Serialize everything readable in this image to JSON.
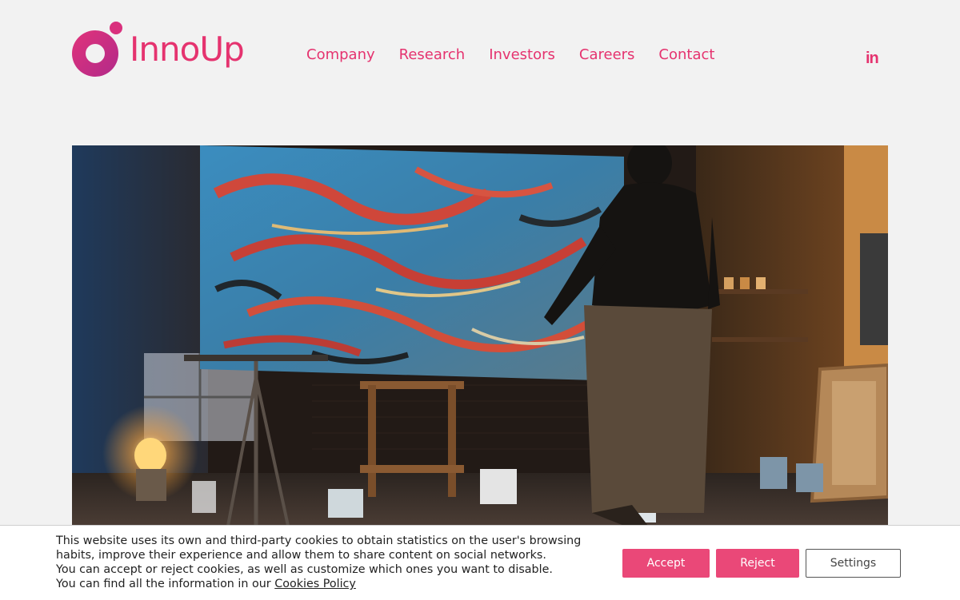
{
  "brand": {
    "name": "InnoUp",
    "accent": "#e5336f",
    "logo_gradient": [
      "#e1337a",
      "#b12a8a"
    ]
  },
  "nav": {
    "items": [
      {
        "label": "Company"
      },
      {
        "label": "Research"
      },
      {
        "label": "Investors"
      },
      {
        "label": "Careers"
      },
      {
        "label": "Contact"
      }
    ]
  },
  "social": {
    "linkedin_label": "in",
    "icon": "linkedin-icon"
  },
  "hero": {
    "image": "artist-painting-in-studio"
  },
  "cookie_banner": {
    "lines": [
      "This website uses its own and third-party cookies to obtain statistics on the user's browsing",
      "habits, improve their experience and allow them to share content on social networks.",
      "You can accept or reject cookies, as well as customize which ones you want to disable."
    ],
    "last_line_prefix": "You can find all the information in our ",
    "policy_link": "Cookies Policy",
    "accept_label": "Accept",
    "reject_label": "Reject",
    "settings_label": "Settings",
    "button_color": "#ea4878"
  }
}
